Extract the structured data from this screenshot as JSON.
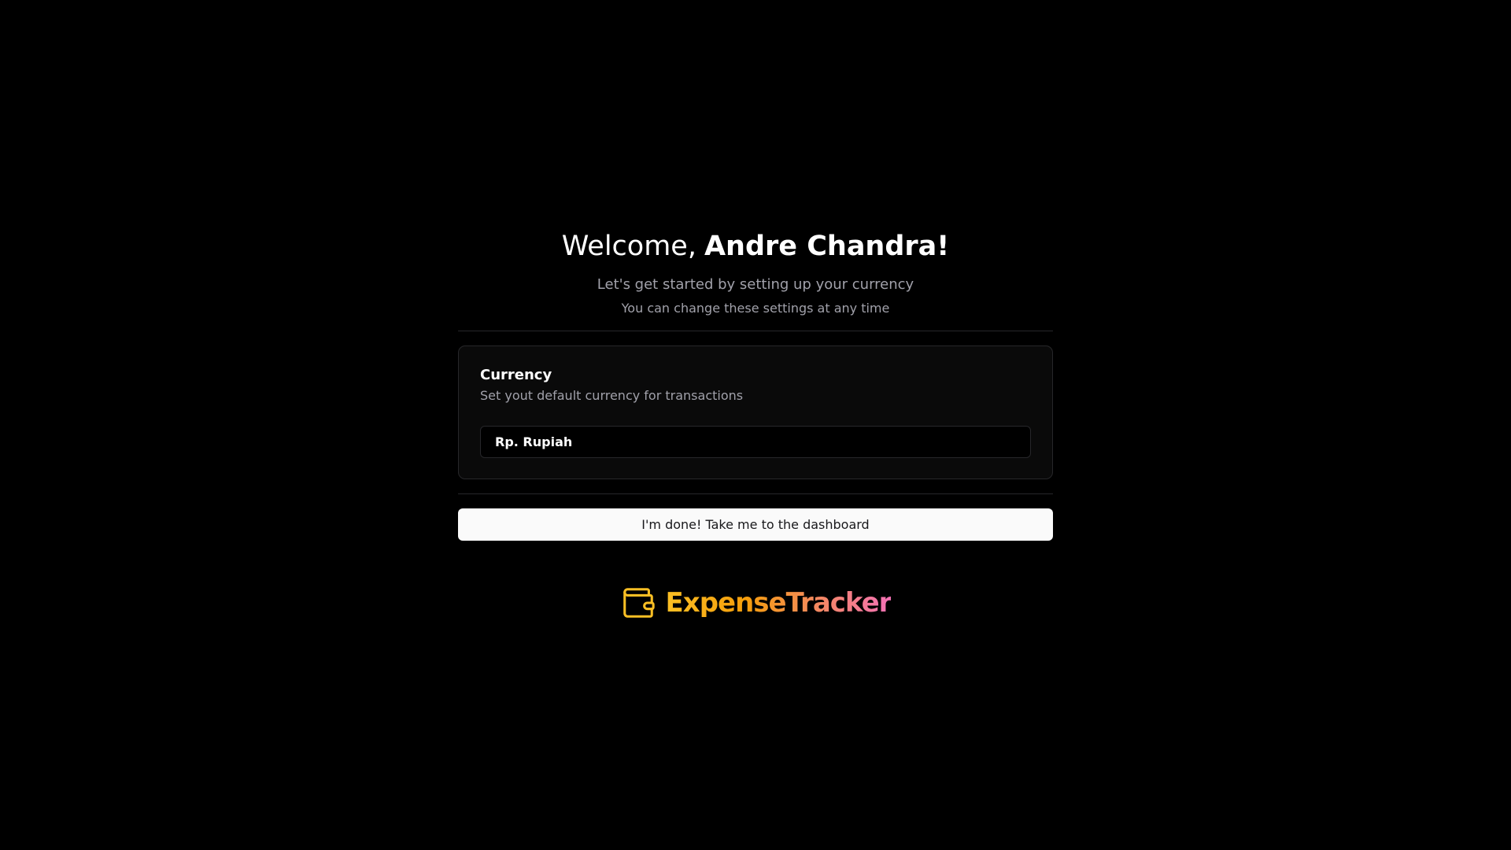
{
  "welcome": {
    "greeting": "Welcome,",
    "name": "Andre Chandra!"
  },
  "intro": {
    "subtitle": "Let's get started by setting up your currency",
    "note": "You can change these settings at any time"
  },
  "currency_card": {
    "title": "Currency",
    "description": "Set yout default currency for transactions",
    "selected_value": "Rp. Rupiah"
  },
  "actions": {
    "done_label": "I'm done! Take me to the dashboard"
  },
  "brand": {
    "name": "ExpenseTracker",
    "icon": "wallet-icon",
    "gradient": [
      "#fbbf24",
      "#f59e0b",
      "#f472b6"
    ]
  },
  "colors": {
    "background": "#000000",
    "card": "#0a0a0a",
    "border": "#27272a",
    "muted_text": "#a1a1aa",
    "button_bg": "#fafafa"
  }
}
